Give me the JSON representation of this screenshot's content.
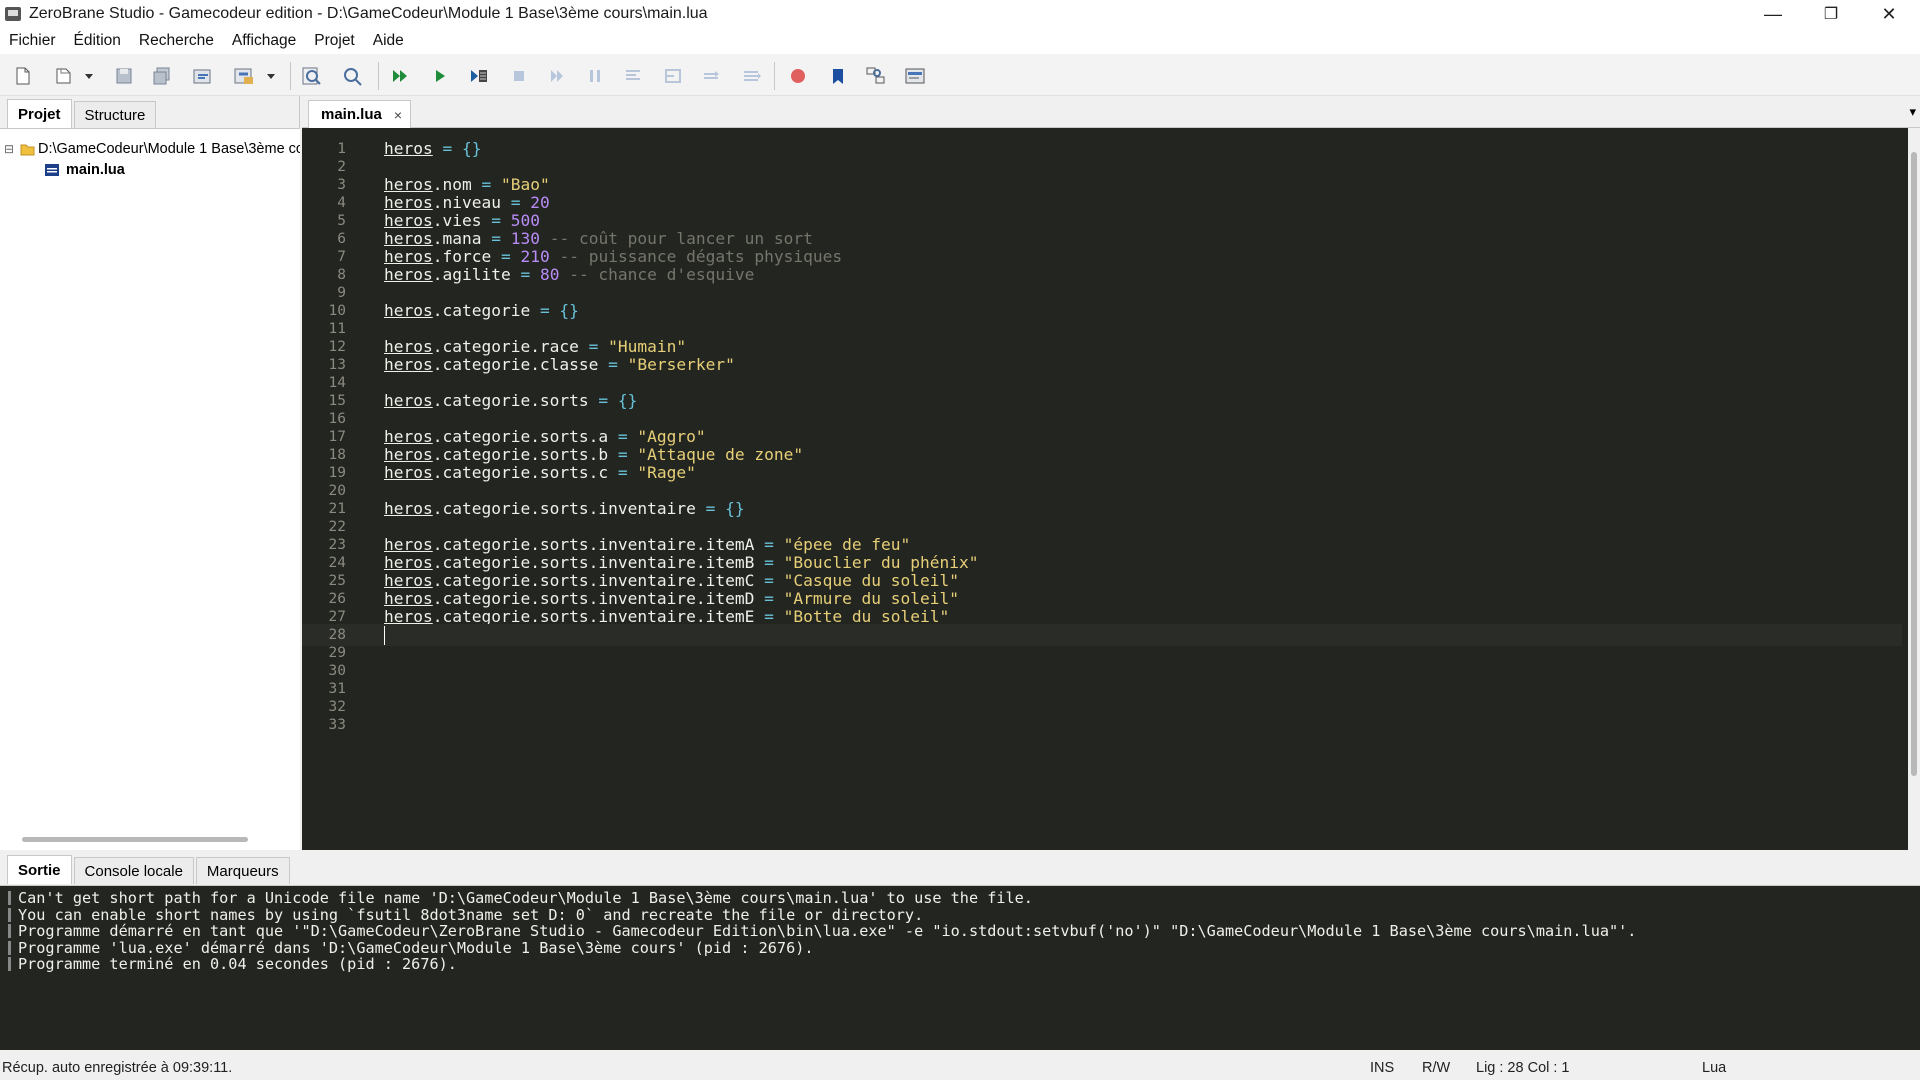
{
  "window": {
    "title": "ZeroBrane Studio - Gamecodeur edition - D:\\GameCodeur\\Module 1 Base\\3ème cours\\main.lua",
    "minimize": "—",
    "restore": "❐",
    "close": "✕"
  },
  "menu": [
    "Fichier",
    "Édition",
    "Recherche",
    "Affichage",
    "Projet",
    "Aide"
  ],
  "toolbar": {
    "icons": [
      "new-file-icon",
      "open-file-icon",
      "dropdown-icon",
      "save-icon",
      "save-all-icon",
      "project-directory-icon",
      "find-in-files-icon",
      "dropdown-icon",
      "find-icon",
      "replace-icon",
      "run-icon",
      "start-debug-icon",
      "step-over-to-cursor-icon",
      "stop-icon",
      "step-into-icon",
      "pause-icon",
      "step-out-icon",
      "step-icon",
      "step-over-icon",
      "break-icon",
      "toggle-breakpoint-icon",
      "toggle-bookmark-icon",
      "outline-icon",
      "commandbar-icon"
    ]
  },
  "left_panel": {
    "tabs": [
      "Projet",
      "Structure"
    ],
    "active_tab": "Projet",
    "tree": {
      "root": "D:\\GameCodeur\\Module 1 Base\\3ème cours",
      "root_toggle": "⊟",
      "files": [
        "main.lua"
      ]
    }
  },
  "editor": {
    "tab": "main.lua",
    "tab_close": "×",
    "tab_menu": "▾",
    "lines": [
      [
        {
          "t": "heros",
          "c": "u"
        },
        {
          "t": " "
        },
        {
          "t": "= {}",
          "c": "o"
        }
      ],
      [],
      [
        {
          "t": "heros",
          "c": "u"
        },
        {
          "t": ".nom "
        },
        {
          "t": "=",
          "c": "o"
        },
        {
          "t": " "
        },
        {
          "t": "\"Bao\"",
          "c": "s"
        }
      ],
      [
        {
          "t": "heros",
          "c": "u"
        },
        {
          "t": ".niveau "
        },
        {
          "t": "=",
          "c": "o"
        },
        {
          "t": " "
        },
        {
          "t": "20",
          "c": "n"
        }
      ],
      [
        {
          "t": "heros",
          "c": "u"
        },
        {
          "t": ".vies "
        },
        {
          "t": "=",
          "c": "o"
        },
        {
          "t": " "
        },
        {
          "t": "500",
          "c": "n"
        }
      ],
      [
        {
          "t": "heros",
          "c": "u"
        },
        {
          "t": ".mana "
        },
        {
          "t": "=",
          "c": "o"
        },
        {
          "t": " "
        },
        {
          "t": "130",
          "c": "n"
        },
        {
          "t": " -- coût pour lancer un sort",
          "c": "c"
        }
      ],
      [
        {
          "t": "heros",
          "c": "u"
        },
        {
          "t": ".force "
        },
        {
          "t": "=",
          "c": "o"
        },
        {
          "t": " "
        },
        {
          "t": "210",
          "c": "n"
        },
        {
          "t": " -- puissance dégats physiques",
          "c": "c"
        }
      ],
      [
        {
          "t": "heros",
          "c": "u"
        },
        {
          "t": ".agilite "
        },
        {
          "t": "=",
          "c": "o"
        },
        {
          "t": " "
        },
        {
          "t": "80",
          "c": "n"
        },
        {
          "t": " -- chance d'esquive",
          "c": "c"
        }
      ],
      [],
      [
        {
          "t": "heros",
          "c": "u"
        },
        {
          "t": ".categorie "
        },
        {
          "t": "= {}",
          "c": "o"
        }
      ],
      [],
      [
        {
          "t": "heros",
          "c": "u"
        },
        {
          "t": ".categorie.race "
        },
        {
          "t": "=",
          "c": "o"
        },
        {
          "t": " "
        },
        {
          "t": "\"Humain\"",
          "c": "s"
        }
      ],
      [
        {
          "t": "heros",
          "c": "u"
        },
        {
          "t": ".categorie.classe "
        },
        {
          "t": "=",
          "c": "o"
        },
        {
          "t": " "
        },
        {
          "t": "\"Berserker\"",
          "c": "s"
        }
      ],
      [],
      [
        {
          "t": "heros",
          "c": "u"
        },
        {
          "t": ".categorie.sorts "
        },
        {
          "t": "= {}",
          "c": "o"
        }
      ],
      [],
      [
        {
          "t": "heros",
          "c": "u"
        },
        {
          "t": ".categorie.sorts.a "
        },
        {
          "t": "=",
          "c": "o"
        },
        {
          "t": " "
        },
        {
          "t": "\"Aggro\"",
          "c": "s"
        }
      ],
      [
        {
          "t": "heros",
          "c": "u"
        },
        {
          "t": ".categorie.sorts.b "
        },
        {
          "t": "=",
          "c": "o"
        },
        {
          "t": " "
        },
        {
          "t": "\"Attaque de zone\"",
          "c": "s"
        }
      ],
      [
        {
          "t": "heros",
          "c": "u"
        },
        {
          "t": ".categorie.sorts.c "
        },
        {
          "t": "=",
          "c": "o"
        },
        {
          "t": " "
        },
        {
          "t": "\"Rage\"",
          "c": "s"
        }
      ],
      [],
      [
        {
          "t": "heros",
          "c": "u"
        },
        {
          "t": ".categorie.sorts.inventaire "
        },
        {
          "t": "= {}",
          "c": "o"
        }
      ],
      [],
      [
        {
          "t": "heros",
          "c": "u"
        },
        {
          "t": ".categorie.sorts.inventaire.itemA "
        },
        {
          "t": "=",
          "c": "o"
        },
        {
          "t": " "
        },
        {
          "t": "\"épee de feu\"",
          "c": "s"
        }
      ],
      [
        {
          "t": "heros",
          "c": "u"
        },
        {
          "t": ".categorie.sorts.inventaire.itemB "
        },
        {
          "t": "=",
          "c": "o"
        },
        {
          "t": " "
        },
        {
          "t": "\"Bouclier du phénix\"",
          "c": "s"
        }
      ],
      [
        {
          "t": "heros",
          "c": "u"
        },
        {
          "t": ".categorie.sorts.inventaire.itemC "
        },
        {
          "t": "=",
          "c": "o"
        },
        {
          "t": " "
        },
        {
          "t": "\"Casque du soleil\"",
          "c": "s"
        }
      ],
      [
        {
          "t": "heros",
          "c": "u"
        },
        {
          "t": ".categorie.sorts.inventaire.itemD "
        },
        {
          "t": "=",
          "c": "o"
        },
        {
          "t": " "
        },
        {
          "t": "\"Armure du soleil\"",
          "c": "s"
        }
      ],
      [
        {
          "t": "heros",
          "c": "u"
        },
        {
          "t": ".categorie.sorts.inventaire.itemE "
        },
        {
          "t": "=",
          "c": "o"
        },
        {
          "t": " "
        },
        {
          "t": "\"Botte du soleil\"",
          "c": "s"
        }
      ],
      [],
      [],
      [],
      [],
      [],
      []
    ],
    "visible_line_numbers": [
      "1",
      "2",
      "3",
      "4",
      "5",
      "6",
      "7",
      "8",
      "9",
      "10",
      "11",
      "12",
      "13",
      "14",
      "15",
      "16",
      "17",
      "18",
      "19",
      "20",
      "21",
      "22",
      "23",
      "24",
      "25",
      "26",
      "27",
      "28",
      "29",
      "30",
      "31",
      "32",
      "33"
    ],
    "current_line": 28
  },
  "bottom_panel": {
    "tabs": [
      "Sortie",
      "Console locale",
      "Marqueurs"
    ],
    "active_tab": "Sortie",
    "output": [
      "Can't get short path for a Unicode file name 'D:\\GameCodeur\\Module 1 Base\\3ème cours\\main.lua' to use the file.",
      "You can enable short names by using `fsutil 8dot3name set D: 0` and recreate the file or directory.",
      "Programme démarré en tant que '\"D:\\GameCodeur\\ZeroBrane Studio - Gamecodeur Edition\\bin\\lua.exe\" -e \"io.stdout:setvbuf('no')\" \"D:\\GameCodeur\\Module 1 Base\\3ème cours\\main.lua\"'.",
      "Programme 'lua.exe' démarré dans 'D:\\GameCodeur\\Module 1 Base\\3ème cours' (pid : 2676).",
      "Programme terminé en 0.04 secondes (pid : 2676)."
    ]
  },
  "status": {
    "message": "Récup. auto enregistrée à 09:39:11.",
    "mode": "INS",
    "access": "R/W",
    "position": "Lig : 28 Col : 1",
    "language": "Lua"
  },
  "colors": {
    "editor_bg": "#232520",
    "operator": "#68c1d8",
    "number": "#b98cf7",
    "string": "#e7cf78",
    "comment": "#75756c"
  }
}
